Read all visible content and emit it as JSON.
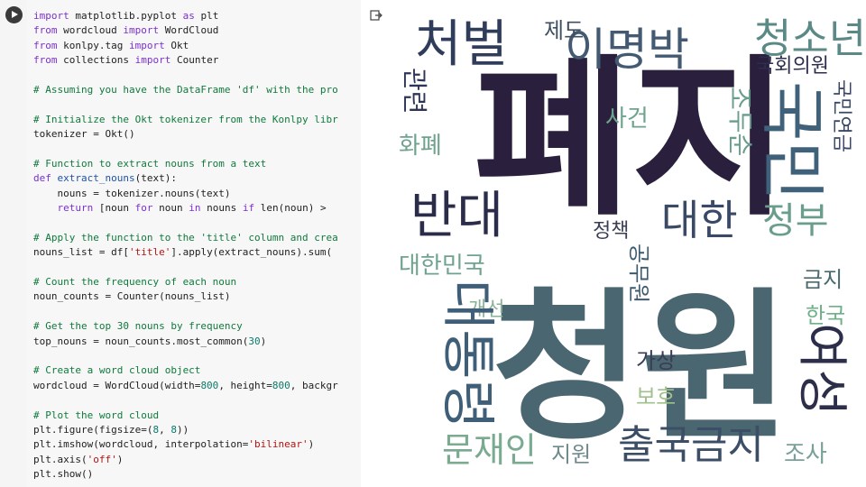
{
  "code_cell": {
    "run_button_icon": "play-icon",
    "lines": [
      [
        [
          "kw",
          "import"
        ],
        [
          "t",
          " matplotlib.pyplot "
        ],
        [
          "kw",
          "as"
        ],
        [
          "t",
          " plt"
        ]
      ],
      [
        [
          "kw",
          "from"
        ],
        [
          "t",
          " wordcloud "
        ],
        [
          "kw",
          "import"
        ],
        [
          "t",
          " WordCloud"
        ]
      ],
      [
        [
          "kw",
          "from"
        ],
        [
          "t",
          " konlpy.tag "
        ],
        [
          "kw",
          "import"
        ],
        [
          "t",
          " Okt"
        ]
      ],
      [
        [
          "kw",
          "from"
        ],
        [
          "t",
          " collections "
        ],
        [
          "kw",
          "import"
        ],
        [
          "t",
          " Counter"
        ]
      ],
      [],
      [
        [
          "cm",
          "# Assuming you have the DataFrame 'df' with the pro"
        ]
      ],
      [],
      [
        [
          "cm",
          "# Initialize the Okt tokenizer from the Konlpy libr"
        ]
      ],
      [
        [
          "t",
          "tokenizer = Okt()"
        ]
      ],
      [],
      [
        [
          "cm",
          "# Function to extract nouns from a text"
        ]
      ],
      [
        [
          "kw",
          "def"
        ],
        [
          "t",
          " "
        ],
        [
          "fn",
          "extract_nouns"
        ],
        [
          "t",
          "(text):"
        ]
      ],
      [
        [
          "t",
          "    nouns = tokenizer.nouns(text)"
        ]
      ],
      [
        [
          "t",
          "    "
        ],
        [
          "kw",
          "return"
        ],
        [
          "t",
          " [noun "
        ],
        [
          "kw",
          "for"
        ],
        [
          "t",
          " noun "
        ],
        [
          "kw",
          "in"
        ],
        [
          "t",
          " nouns "
        ],
        [
          "kw",
          "if"
        ],
        [
          "t",
          " len(noun) >"
        ]
      ],
      [],
      [
        [
          "cm",
          "# Apply the function to the 'title' column and crea"
        ]
      ],
      [
        [
          "t",
          "nouns_list = df["
        ],
        [
          "str",
          "'title'"
        ],
        [
          "t",
          "].apply(extract_nouns).sum("
        ]
      ],
      [],
      [
        [
          "cm",
          "# Count the frequency of each noun"
        ]
      ],
      [
        [
          "t",
          "noun_counts = Counter(nouns_list)"
        ]
      ],
      [],
      [
        [
          "cm",
          "# Get the top 30 nouns by frequency"
        ]
      ],
      [
        [
          "t",
          "top_nouns = noun_counts.most_common("
        ],
        [
          "num",
          "30"
        ],
        [
          "t",
          ")"
        ]
      ],
      [],
      [
        [
          "cm",
          "# Create a word cloud object"
        ]
      ],
      [
        [
          "t",
          "wordcloud = WordCloud(width="
        ],
        [
          "num",
          "800"
        ],
        [
          "t",
          ", height="
        ],
        [
          "num",
          "800"
        ],
        [
          "t",
          ", backgr"
        ]
      ],
      [],
      [
        [
          "cm",
          "# Plot the word cloud"
        ]
      ],
      [
        [
          "t",
          "plt.figure(figsize=("
        ],
        [
          "num",
          "8"
        ],
        [
          "t",
          ", "
        ],
        [
          "num",
          "8"
        ],
        [
          "t",
          "))"
        ]
      ],
      [
        [
          "t",
          "plt.imshow(wordcloud, interpolation="
        ],
        [
          "str",
          "'bilinear'"
        ],
        [
          "t",
          ")"
        ]
      ],
      [
        [
          "t",
          "plt.axis("
        ],
        [
          "str",
          "'off'"
        ],
        [
          "t",
          ")"
        ]
      ],
      [
        [
          "t",
          "plt.show()"
        ]
      ]
    ]
  },
  "output": {
    "output_icon": "output-redirect-icon",
    "wordcloud_words": [
      {
        "text": "폐지",
        "color": "#2a1f3d"
      },
      {
        "text": "청원",
        "color": "#4a6670"
      },
      {
        "text": "처벌",
        "color": "#2f3c5a"
      },
      {
        "text": "이명박",
        "color": "#445a73"
      },
      {
        "text": "청소년",
        "color": "#5b8a86"
      },
      {
        "text": "제도",
        "color": "#3f4f60"
      },
      {
        "text": "국회의원",
        "color": "#2d2e4e"
      },
      {
        "text": "국민",
        "color": "#40617a"
      },
      {
        "text": "관련",
        "color": "#2f3556"
      },
      {
        "text": "조두순",
        "color": "#6a9e8c"
      },
      {
        "text": "국민연금",
        "color": "#3a4868"
      },
      {
        "text": "사건",
        "color": "#6fa38e"
      },
      {
        "text": "화폐",
        "color": "#6fa38e"
      },
      {
        "text": "반대",
        "color": "#2b2c4a"
      },
      {
        "text": "대한",
        "color": "#3a4a66"
      },
      {
        "text": "정부",
        "color": "#6a9e8c"
      },
      {
        "text": "정책",
        "color": "#3a3e55"
      },
      {
        "text": "공무원",
        "color": "#3d5a6e"
      },
      {
        "text": "대한민국",
        "color": "#6fa38e"
      },
      {
        "text": "금지",
        "color": "#4a6a6e"
      },
      {
        "text": "개선",
        "color": "#8ab39a"
      },
      {
        "text": "대통령",
        "color": "#3f5e78"
      },
      {
        "text": "한국",
        "color": "#6fb088"
      },
      {
        "text": "가상",
        "color": "#3a3d55"
      },
      {
        "text": "보호",
        "color": "#a0c08c"
      },
      {
        "text": "여성",
        "color": "#2c2e4a"
      },
      {
        "text": "문재인",
        "color": "#7aaa90"
      },
      {
        "text": "지원",
        "color": "#6e8a8c"
      },
      {
        "text": "출국금지",
        "color": "#3c4e66"
      },
      {
        "text": "조사",
        "color": "#7aa09a"
      }
    ]
  }
}
